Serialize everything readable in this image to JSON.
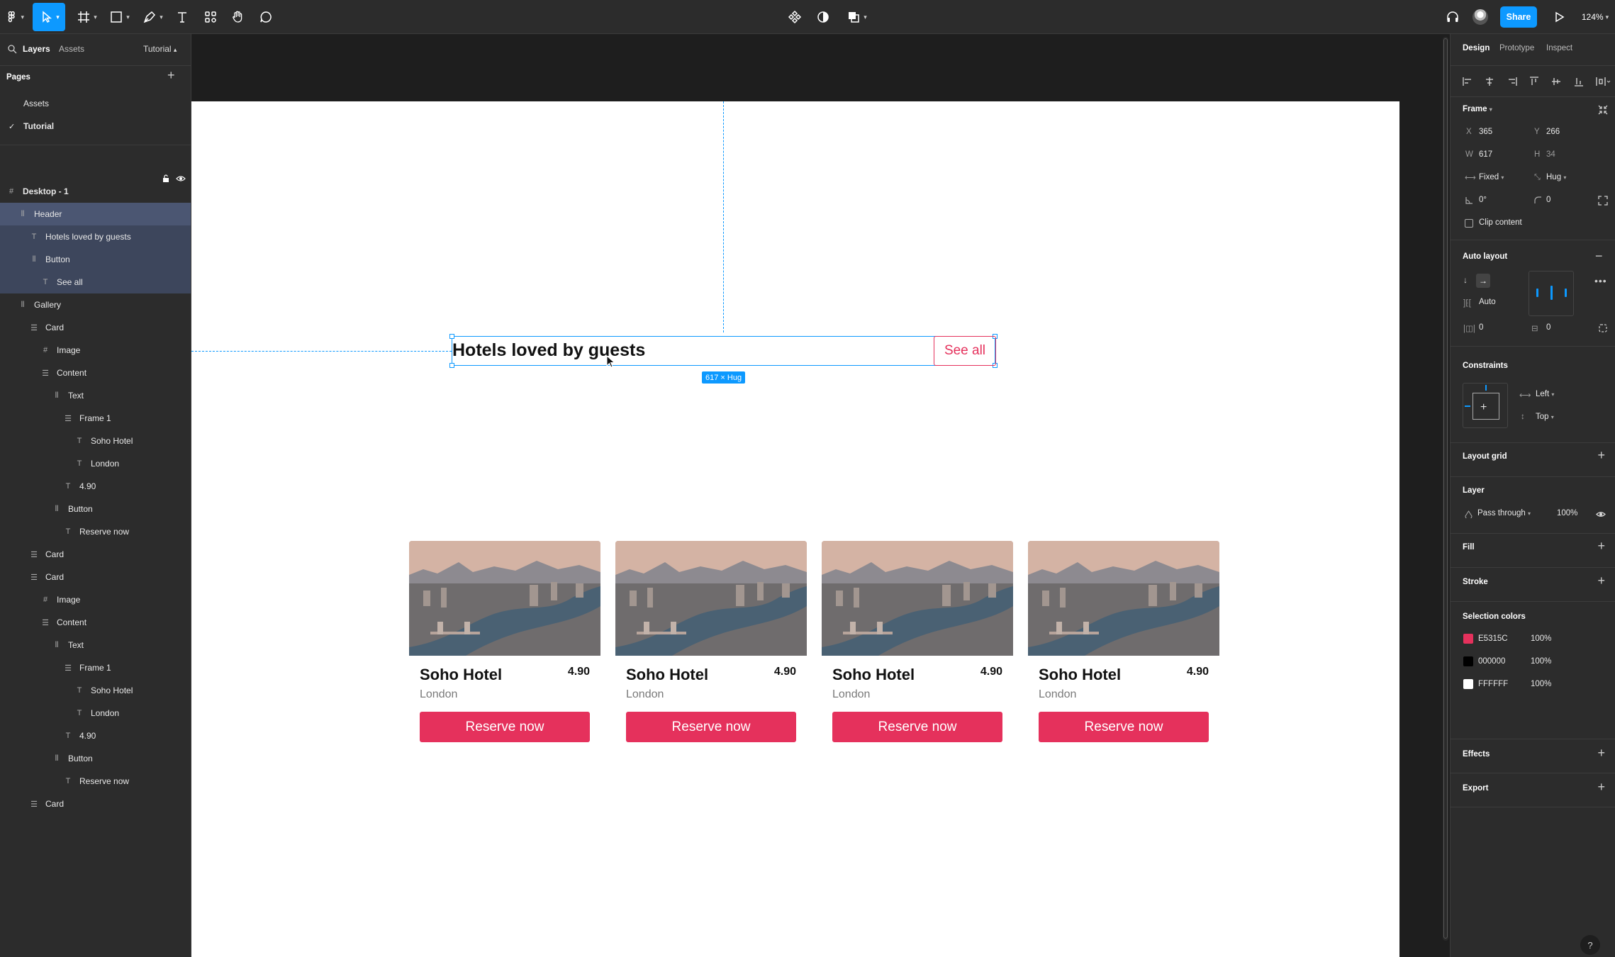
{
  "toolbar": {
    "share_label": "Share",
    "zoom": "124%"
  },
  "left_panel": {
    "tabs": [
      "Layers",
      "Assets"
    ],
    "page_switcher": "Tutorial",
    "pages_heading": "Pages",
    "pages": [
      "Assets",
      "Tutorial"
    ],
    "layers": [
      {
        "label": "Desktop - 1",
        "depth": 0,
        "icon": "frame-icon"
      },
      {
        "label": "Header",
        "depth": 1,
        "icon": "autolayout-h-icon"
      },
      {
        "label": "Hotels loved by guests",
        "depth": 2,
        "icon": "text-icon"
      },
      {
        "label": "Button",
        "depth": 2,
        "icon": "autolayout-h-icon"
      },
      {
        "label": "See all",
        "depth": 3,
        "icon": "text-icon"
      },
      {
        "label": "Gallery",
        "depth": 1,
        "icon": "autolayout-h-icon"
      },
      {
        "label": "Card",
        "depth": 2,
        "icon": "autolayout-v-icon"
      },
      {
        "label": "Image",
        "depth": 3,
        "icon": "frame-icon"
      },
      {
        "label": "Content",
        "depth": 3,
        "icon": "autolayout-v-icon"
      },
      {
        "label": "Text",
        "depth": 4,
        "icon": "autolayout-h-icon"
      },
      {
        "label": "Frame 1",
        "depth": 5,
        "icon": "autolayout-v-icon"
      },
      {
        "label": "Soho Hotel",
        "depth": 6,
        "icon": "text-icon"
      },
      {
        "label": "London",
        "depth": 6,
        "icon": "text-icon"
      },
      {
        "label": "4.90",
        "depth": 5,
        "icon": "text-icon"
      },
      {
        "label": "Button",
        "depth": 4,
        "icon": "autolayout-h-icon"
      },
      {
        "label": "Reserve now",
        "depth": 5,
        "icon": "text-icon"
      },
      {
        "label": "Card",
        "depth": 2,
        "icon": "autolayout-v-icon"
      },
      {
        "label": "Card",
        "depth": 2,
        "icon": "autolayout-v-icon"
      },
      {
        "label": "Image",
        "depth": 3,
        "icon": "frame-icon"
      },
      {
        "label": "Content",
        "depth": 3,
        "icon": "autolayout-v-icon"
      },
      {
        "label": "Text",
        "depth": 4,
        "icon": "autolayout-h-icon"
      },
      {
        "label": "Frame 1",
        "depth": 5,
        "icon": "autolayout-v-icon"
      },
      {
        "label": "Soho Hotel",
        "depth": 6,
        "icon": "text-icon"
      },
      {
        "label": "London",
        "depth": 6,
        "icon": "text-icon"
      },
      {
        "label": "4.90",
        "depth": 5,
        "icon": "text-icon"
      },
      {
        "label": "Button",
        "depth": 4,
        "icon": "autolayout-h-icon"
      },
      {
        "label": "Reserve now",
        "depth": 5,
        "icon": "text-icon"
      },
      {
        "label": "Card",
        "depth": 2,
        "icon": "autolayout-v-icon"
      }
    ]
  },
  "canvas": {
    "header_title": "Hotels loved by guests",
    "see_all": "See all",
    "size_badge": "617 × Hug",
    "cards": [
      {
        "name": "Soho Hotel",
        "rating": "4.90",
        "city": "London",
        "button": "Reserve now"
      },
      {
        "name": "Soho Hotel",
        "rating": "4.90",
        "city": "London",
        "button": "Reserve now"
      },
      {
        "name": "Soho Hotel",
        "rating": "4.90",
        "city": "London",
        "button": "Reserve now"
      },
      {
        "name": "Soho Hotel",
        "rating": "4.90",
        "city": "London",
        "button": "Reserve now"
      }
    ]
  },
  "right_panel": {
    "tabs": [
      "Design",
      "Prototype",
      "Inspect"
    ],
    "frame_heading": "Frame",
    "x_label": "X",
    "x_value": "365",
    "y_label": "Y",
    "y_value": "266",
    "w_label": "W",
    "w_value": "617",
    "h_label": "H",
    "h_value": "34",
    "width_mode": "Fixed",
    "height_mode": "Hug",
    "rotation": "0°",
    "radius": "0",
    "clip_content": "Clip content",
    "auto_layout_heading": "Auto layout",
    "spacing": "Auto",
    "padding_h": "0",
    "padding_v": "0",
    "constraints_heading": "Constraints",
    "constraint_h": "Left",
    "constraint_v": "Top",
    "layout_grid": "Layout grid",
    "layer_heading": "Layer",
    "blend": "Pass through",
    "opacity": "100%",
    "fill": "Fill",
    "stroke": "Stroke",
    "selection_colors_heading": "Selection colors",
    "selection_colors": [
      {
        "hex": "E5315C",
        "opacity": "100%",
        "color": "#E5315C"
      },
      {
        "hex": "000000",
        "opacity": "100%",
        "color": "#000000"
      },
      {
        "hex": "FFFFFF",
        "opacity": "100%",
        "color": "#FFFFFF"
      }
    ],
    "effects": "Effects",
    "export": "Export"
  },
  "help": "?"
}
